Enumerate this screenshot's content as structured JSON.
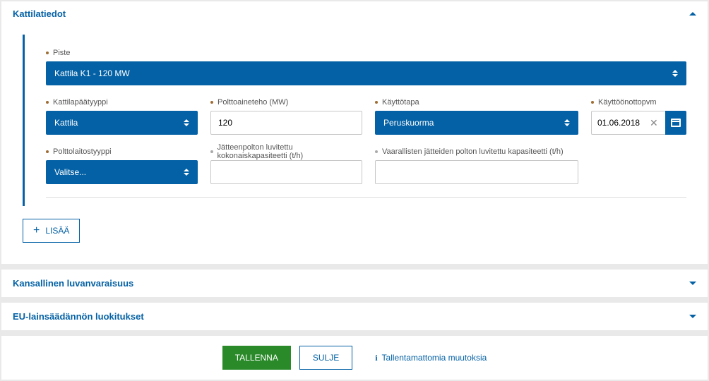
{
  "panels": {
    "kattilatiedot": "Kattilatiedot",
    "kansallinen": "Kansallinen luvanvaraisuus",
    "eu": "EU-lainsäädännön luokitukset"
  },
  "fields": {
    "piste": {
      "label": "Piste",
      "value": "Kattila K1 - 120 MW"
    },
    "kattilapaatyyppi": {
      "label": "Kattilapäätyyppi",
      "value": "Kattila"
    },
    "polttoaineteho": {
      "label": "Polttoaineteho (MW)",
      "value": "120"
    },
    "kayttotapa": {
      "label": "Käyttötapa",
      "value": "Peruskuorma"
    },
    "kayttoonottopvm": {
      "label": "Käyttöönottopvm",
      "value": "01.06.2018"
    },
    "polttolaitostyyppi": {
      "label": "Polttolaitostyyppi",
      "value": "Valitse..."
    },
    "jatteenpolton": {
      "label": "Jätteenpolton luvitettu kokonaiskapasiteetti (t/h)",
      "value": ""
    },
    "vaarallisten": {
      "label": "Vaarallisten jätteiden polton luvitettu kapasiteetti (t/h)",
      "value": ""
    }
  },
  "buttons": {
    "add": "LISÄÄ",
    "save": "TALLENNA",
    "close": "SULJE"
  },
  "status": "Tallentamattomia muutoksia"
}
